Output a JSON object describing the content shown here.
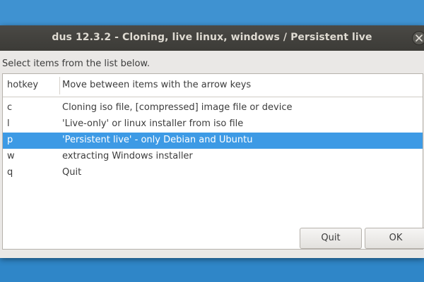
{
  "window": {
    "title": "dus 12.3.2 - Cloning, live linux, windows / Persistent live"
  },
  "prompt": "Select items from the list below.",
  "list": {
    "columns": [
      "hotkey",
      "Move between items with the arrow keys"
    ],
    "rows": [
      {
        "hotkey": "c",
        "description": "Cloning iso file, [compressed] image file or device",
        "selected": false
      },
      {
        "hotkey": "l",
        "description": "'Live-only' or linux installer from iso file",
        "selected": false
      },
      {
        "hotkey": "p",
        "description": "'Persistent live' - only Debian and Ubuntu",
        "selected": true
      },
      {
        "hotkey": "w",
        "description": "extracting Windows installer",
        "selected": false
      },
      {
        "hotkey": "q",
        "description": "Quit",
        "selected": false
      }
    ]
  },
  "buttons": {
    "quit": "Quit",
    "ok": "OK"
  },
  "colors": {
    "selection": "#3d9ae5",
    "desktop": "#2a7fc2",
    "titlebar": "#3c3b37"
  }
}
